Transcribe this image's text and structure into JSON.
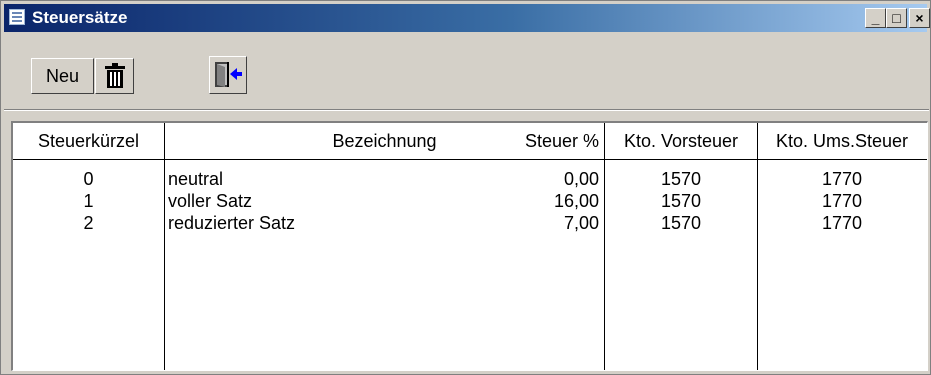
{
  "window": {
    "title": "Steuersätze",
    "controls": {
      "minimize": "_",
      "maximize": "□",
      "close": "×"
    }
  },
  "toolbar": {
    "new_label": "Neu",
    "delete_icon": "trash-icon",
    "exit_icon": "exit-door-icon"
  },
  "table": {
    "columns": [
      "Steuerkürzel",
      "Bezeichnung",
      "Steuer %",
      "Kto. Vorsteuer",
      "Kto. Ums.Steuer"
    ],
    "rows": [
      {
        "code": "0",
        "name": "neutral",
        "rate": "0,00",
        "input_tax": "1570",
        "sales_tax": "1770"
      },
      {
        "code": "1",
        "name": "voller Satz",
        "rate": "16,00",
        "input_tax": "1570",
        "sales_tax": "1770"
      },
      {
        "code": "2",
        "name": "reduzierter Satz",
        "rate": "7,00",
        "input_tax": "1570",
        "sales_tax": "1770"
      }
    ]
  },
  "colors": {
    "titlebar_start": "#0a246a",
    "titlebar_end": "#a6caf0",
    "window_bg": "#d4d0c8"
  }
}
